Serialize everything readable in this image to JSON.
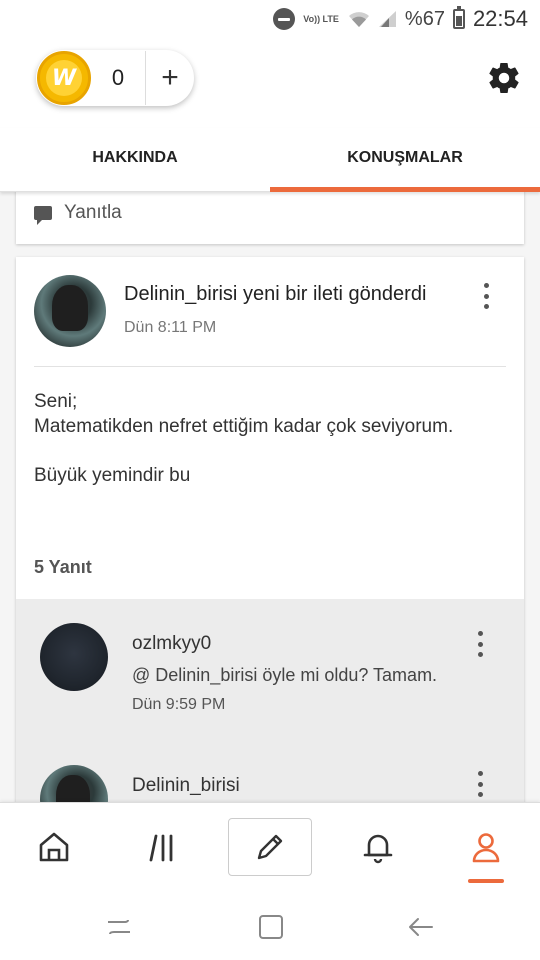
{
  "status_bar": {
    "volte_label": "Vo)) LTE",
    "battery_percent": "%67",
    "time": "22:54"
  },
  "wallet": {
    "coin_letter": "W",
    "coin_count": "0",
    "add_label": "+"
  },
  "tabs": [
    {
      "label": "HAKKINDA",
      "active": false
    },
    {
      "label": "KONUŞMALAR",
      "active": true
    }
  ],
  "previous_card": {
    "reply_label": "Yanıtla"
  },
  "post": {
    "username": "Delinin_birisi",
    "action_text": " yeni bir ileti gönderdi",
    "time": "Dün 8:11 PM",
    "body_lines": [
      "Seni;",
      "Matematikden nefret ettiğim kadar çok seviyorum."
    ],
    "body_line2": "Büyük yemindir bu",
    "reply_count": "5 Yanıt"
  },
  "replies": [
    {
      "username": "ozlmkyy0",
      "text": "@ Delinin_birisi  öyle mi oldu? Tamam.",
      "time": "Dün 9:59 PM"
    },
    {
      "username": "Delinin_birisi"
    }
  ],
  "colors": {
    "accent": "#ec6a3c",
    "coin": "#f5b800",
    "reply_bg": "#ececec"
  },
  "bottom_nav": [
    "home-icon",
    "library-icon",
    "pencil-icon",
    "bell-icon",
    "profile-icon"
  ],
  "system_nav": [
    "recents-icon",
    "home-square-icon",
    "back-icon"
  ]
}
